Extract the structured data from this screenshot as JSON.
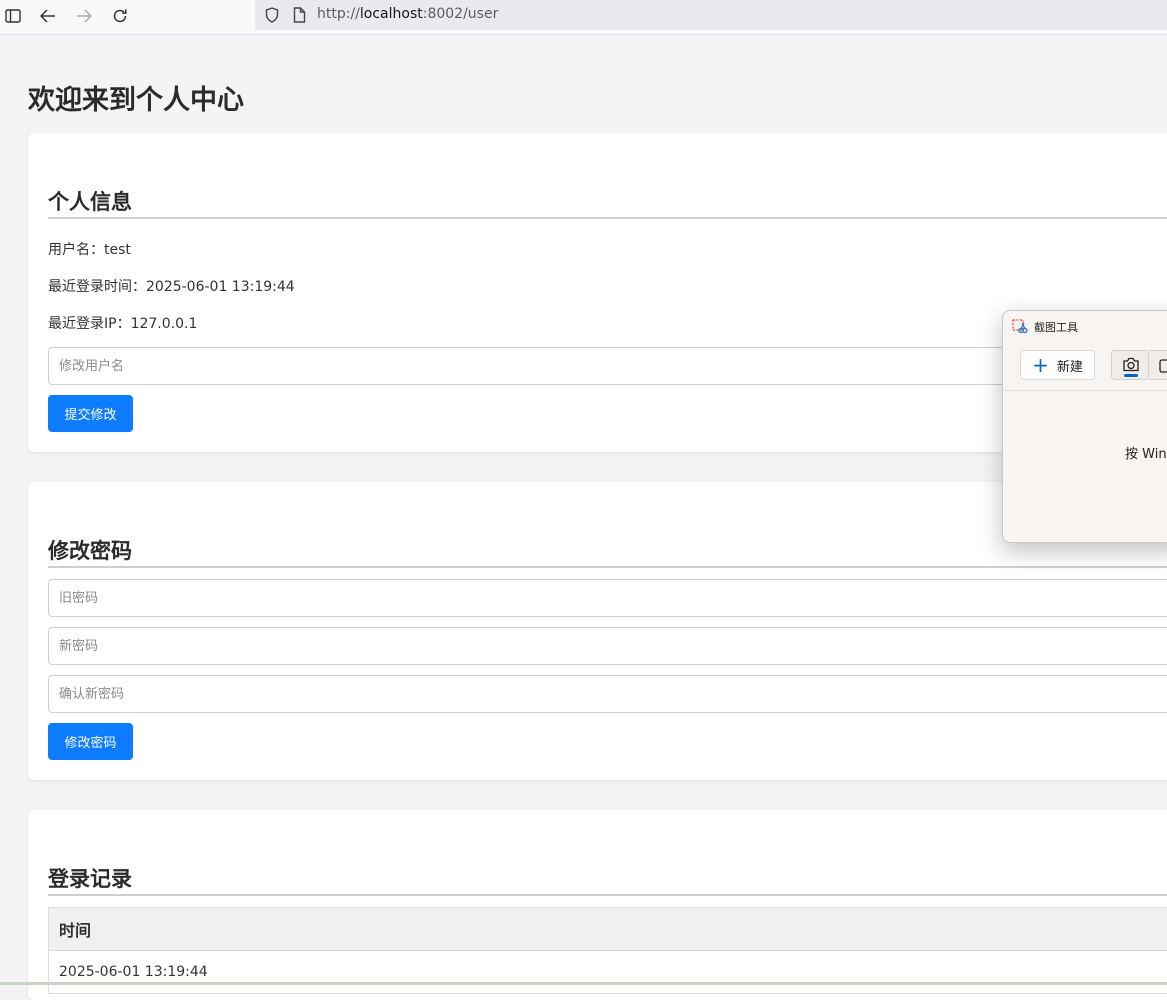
{
  "browser": {
    "url_prefix": "http://",
    "url_host": "localhost",
    "url_rest": ":8002/user"
  },
  "page": {
    "title": "欢迎来到个人中心"
  },
  "profile": {
    "heading": "个人信息",
    "username_label": "用户名：",
    "username_value": "test",
    "last_login_time_label": "最近登录时间：",
    "last_login_time_value": "2025-06-01 13:19:44",
    "last_login_ip_label": "最近登录IP：",
    "last_login_ip_value": "127.0.0.1",
    "new_username_placeholder": "修改用户名",
    "submit_label": "提交修改"
  },
  "password": {
    "heading": "修改密码",
    "old_placeholder": "旧密码",
    "new_placeholder": "新密码",
    "confirm_placeholder": "确认新密码",
    "submit_label": "修改密码"
  },
  "login_records": {
    "heading": "登录记录",
    "columns": [
      "时间"
    ],
    "rows": [
      [
        "2025-06-01 13:19:44"
      ]
    ]
  },
  "snipping_tool": {
    "title": "截图工具",
    "new_label": "新建",
    "hint_text": "按 Win"
  },
  "colors": {
    "primary_button": "#0d7cff",
    "page_background": "#f4f4f4"
  }
}
